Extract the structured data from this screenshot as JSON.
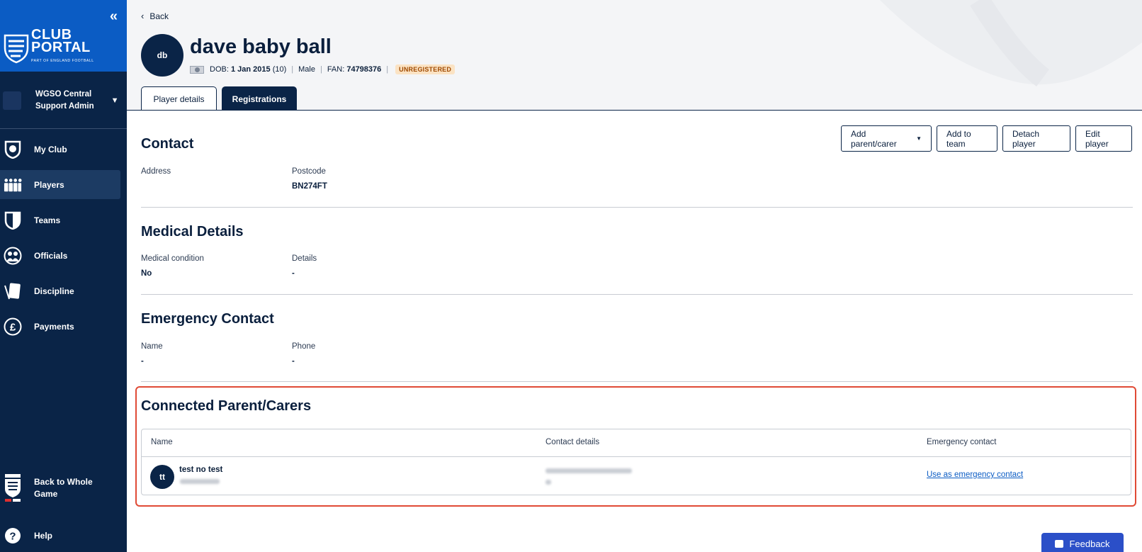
{
  "sidebar": {
    "collapse_glyph": "«",
    "logo": {
      "line1": "CLUB",
      "line2": "PORTAL",
      "line3": "PART OF ENGLAND FOOTBALL"
    },
    "org": {
      "line1": "WGSO Central",
      "line2": "Support Admin"
    },
    "nav": [
      {
        "label": "My Club",
        "icon": "shield-football-icon"
      },
      {
        "label": "Players",
        "icon": "players-icon"
      },
      {
        "label": "Teams",
        "icon": "team-shield-icon"
      },
      {
        "label": "Officials",
        "icon": "officials-icon"
      },
      {
        "label": "Discipline",
        "icon": "card-icon"
      },
      {
        "label": "Payments",
        "icon": "pound-icon"
      }
    ],
    "back_to_whole_game": {
      "line1": "Back to Whole",
      "line2": "Game"
    },
    "help": "Help"
  },
  "header": {
    "back": "Back",
    "avatar_initials": "db",
    "player_name": "dave baby ball",
    "dob_label": "DOB:",
    "dob_value": "1 Jan 2015",
    "age": "(10)",
    "gender": "Male",
    "fan_label": "FAN:",
    "fan_value": "74798376",
    "status_badge": "UNREGISTERED",
    "tabs": [
      {
        "label": "Player details",
        "active": true
      },
      {
        "label": "Registrations",
        "active": false
      }
    ]
  },
  "actions": {
    "add_parent": "Add parent/carer",
    "add_to_team": "Add to team",
    "detach_player": "Detach player",
    "edit_player": "Edit player"
  },
  "contact": {
    "title": "Contact",
    "address_label": "Address",
    "postcode_label": "Postcode",
    "postcode_value": "BN274FT"
  },
  "medical": {
    "title": "Medical Details",
    "condition_label": "Medical condition",
    "condition_value": "No",
    "details_label": "Details",
    "details_value": "-"
  },
  "emergency": {
    "title": "Emergency Contact",
    "name_label": "Name",
    "name_value": "-",
    "phone_label": "Phone",
    "phone_value": "-"
  },
  "parents": {
    "title": "Connected Parent/Carers",
    "columns": [
      "Name",
      "Contact details",
      "Emergency contact"
    ],
    "rows": [
      {
        "initials": "tt",
        "name": "test no test",
        "emergency_action": "Use as emergency contact"
      }
    ]
  },
  "feedback": "Feedback"
}
